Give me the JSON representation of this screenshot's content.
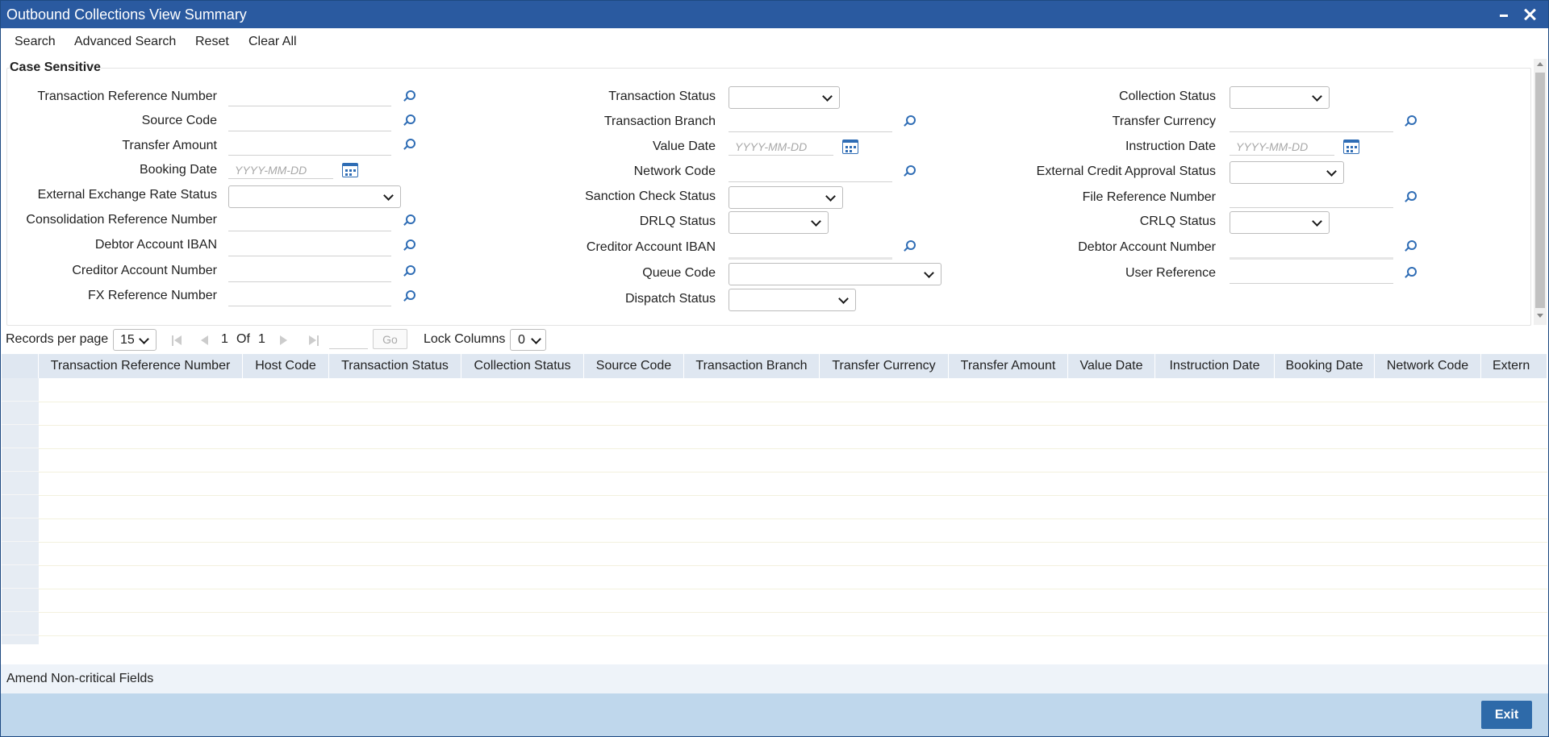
{
  "window": {
    "title": "Outbound Collections View Summary"
  },
  "toolbar": {
    "search": "Search",
    "advanced_search": "Advanced Search",
    "reset": "Reset",
    "clear_all": "Clear All"
  },
  "criteria": {
    "legend": "Case Sensitive",
    "col1": {
      "transaction_reference_number": "Transaction Reference Number",
      "source_code": "Source Code",
      "transfer_amount": "Transfer Amount",
      "booking_date": "Booking Date",
      "external_exchange_rate_status": "External Exchange Rate Status",
      "consolidation_reference_number": "Consolidation Reference Number",
      "debtor_account_iban": "Debtor Account IBAN",
      "creditor_account_number": "Creditor Account Number",
      "fx_reference_number": "FX Reference Number"
    },
    "col2": {
      "transaction_status": "Transaction Status",
      "transaction_branch": "Transaction Branch",
      "value_date": "Value Date",
      "network_code": "Network Code",
      "sanction_check_status": "Sanction Check Status",
      "drlq_status": "DRLQ Status",
      "creditor_account_iban": "Creditor Account IBAN",
      "queue_code": "Queue Code",
      "dispatch_status": "Dispatch Status"
    },
    "col3": {
      "collection_status": "Collection Status",
      "transfer_currency": "Transfer Currency",
      "instruction_date": "Instruction Date",
      "external_credit_approval_status": "External Credit Approval Status",
      "file_reference_number": "File Reference Number",
      "crlq_status": "CRLQ Status",
      "debtor_account_number": "Debtor Account Number",
      "user_reference": "User Reference"
    },
    "date_placeholder": "YYYY-MM-DD"
  },
  "pager": {
    "records_per_page_label": "Records per page",
    "records_per_page": "15",
    "current_page": "1",
    "of_label": "Of",
    "total_pages": "1",
    "go": "Go",
    "lock_columns_label": "Lock Columns",
    "lock_columns": "0"
  },
  "grid": {
    "columns": [
      "Transaction Reference Number",
      "Host Code",
      "Transaction Status",
      "Collection Status",
      "Source Code",
      "Transaction Branch",
      "Transfer Currency",
      "Transfer Amount",
      "Value Date",
      "Instruction Date",
      "Booking Date",
      "Network Code",
      "Extern"
    ]
  },
  "footer": {
    "amend": "Amend Non-critical Fields",
    "exit": "Exit"
  },
  "colors": {
    "title_bar": "#2a5aa0",
    "icon_blue": "#2f6db5",
    "exit_button": "#2e6aa9",
    "bottom_bar": "#bfd7ec"
  }
}
